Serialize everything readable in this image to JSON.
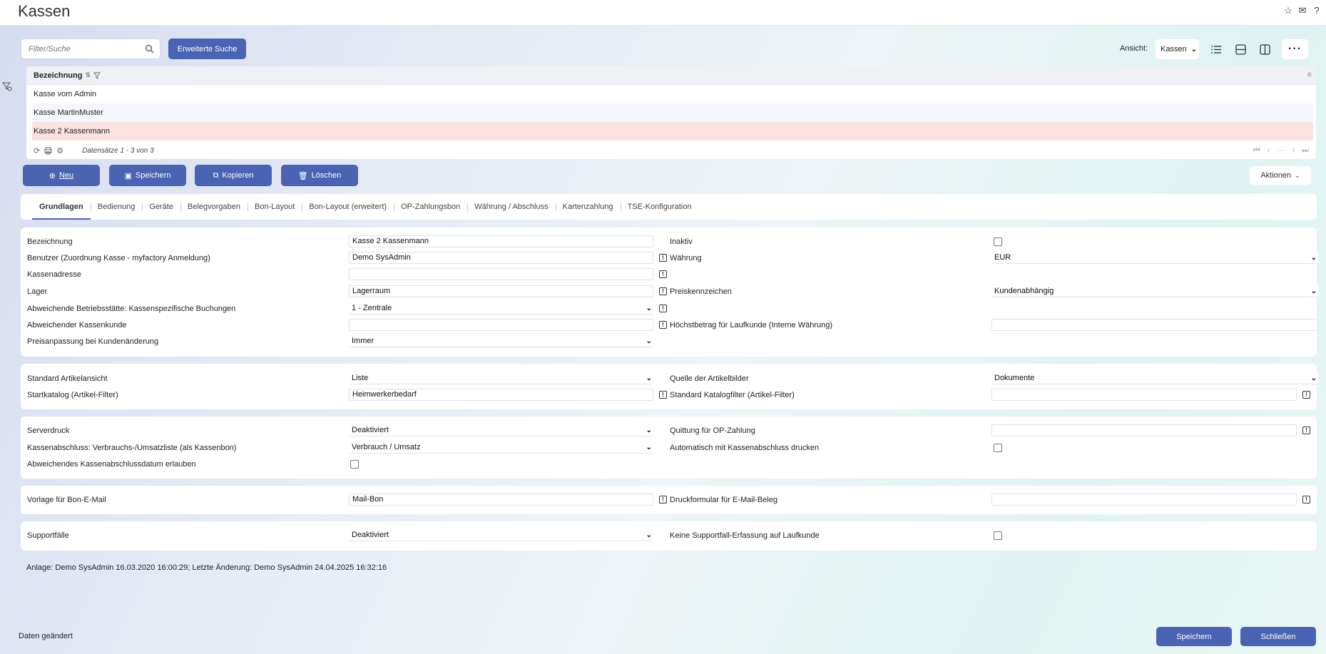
{
  "app": {
    "title": "Kassen"
  },
  "top_icons": [
    "star-icon",
    "mail-icon",
    "help-icon"
  ],
  "search": {
    "placeholder": "Filter/Suche",
    "advanced_label": "Erweiterte Suche"
  },
  "view": {
    "label": "Ansicht:",
    "selected": "Kassen"
  },
  "grid": {
    "column": "Bezeichnung",
    "rows": [
      "Kasse vom Admin",
      "Kasse MartinMuster",
      "Kasse 2 Kassenmann"
    ],
    "count": "Datensätze 1 - 3 von 3"
  },
  "actions": {
    "new": "Neu",
    "save": "Speichern",
    "copy": "Kopieren",
    "delete": "Löschen",
    "more": "Aktionen"
  },
  "tabs": [
    "Grundlagen",
    "Bedienung",
    "Geräte",
    "Belegvorgaben",
    "Bon-Layout",
    "Bon-Layout (erweitert)",
    "OP-Zahlungsbon",
    "Währung / Abschluss",
    "Kartenzahlung",
    "TSE-Konfiguration"
  ],
  "section1": {
    "bezeichnung": {
      "label": "Bezeichnung",
      "value": "Kasse 2 Kassenmann"
    },
    "inaktiv": {
      "label": "Inaktiv"
    },
    "benutzer": {
      "label": "Benutzer (Zuordnung Kasse - myfactory Anmeldung)",
      "value": "Demo SysAdmin"
    },
    "waehrung": {
      "label": "Währung",
      "value": "EUR"
    },
    "kassenadresse": {
      "label": "Kassenadresse",
      "value": ""
    },
    "lager": {
      "label": "Lager",
      "value": "Lagerraum"
    },
    "preiskennzeichen": {
      "label": "Preiskennzeichen",
      "value": "Kundenabhängig"
    },
    "betriebsstaette": {
      "label": "Abweichende Betriebsstätte: Kassenspezifische Buchungen",
      "value": "1 - Zentrale"
    },
    "kassenkunde": {
      "label": "Abweichender Kassenkunde",
      "value": ""
    },
    "hoechstbetrag": {
      "label": "Höchstbetrag für Laufkunde (Interne Währung)",
      "value": ""
    },
    "preisanpassung": {
      "label": "Preisanpassung bei Kundenänderung",
      "value": "Immer"
    }
  },
  "section2": {
    "artikelansicht": {
      "label": "Standard Artikelansicht",
      "value": "Liste"
    },
    "artikelbilder": {
      "label": "Quelle der Artikelbilder",
      "value": "Dokumente"
    },
    "startkatalog": {
      "label": "Startkatalog (Artikel-Filter)",
      "value": "Heimwerkerbedarf"
    },
    "katalogfilter": {
      "label": "Standard Katalogfilter (Artikel-Filter)",
      "value": ""
    }
  },
  "section3": {
    "serverdruck": {
      "label": "Serverdruck",
      "value": "Deaktiviert"
    },
    "quittung": {
      "label": "Quittung für OP-Zahlung",
      "value": ""
    },
    "kassenabschluss": {
      "label": "Kassenabschluss: Verbrauchs-/Umsatzliste (als Kassenbon)",
      "value": "Verbrauch / Umsatz"
    },
    "autodruck": {
      "label": "Automatisch mit Kassenabschluss drucken"
    },
    "abschlussdatum": {
      "label": "Abweichendes Kassenabschlussdatum erlauben"
    }
  },
  "section4": {
    "vorlage": {
      "label": "Vorlage für Bon-E-Mail",
      "value": "Mail-Bon"
    },
    "druckformular": {
      "label": "Druckformular für E-Mail-Beleg",
      "value": ""
    }
  },
  "section5": {
    "supportfaelle": {
      "label": "Supportfälle",
      "value": "Deaktiviert"
    },
    "keine_support": {
      "label": "Keine Supportfall-Erfassung auf Laufkunde"
    }
  },
  "audit": "Anlage: Demo SysAdmin 16.03.2020 16:00:29; Letzte Änderung: Demo SysAdmin 24.04.2025 16:32:16",
  "footer": {
    "status": "Daten geändert",
    "save": "Speichern",
    "close": "Schließen"
  }
}
